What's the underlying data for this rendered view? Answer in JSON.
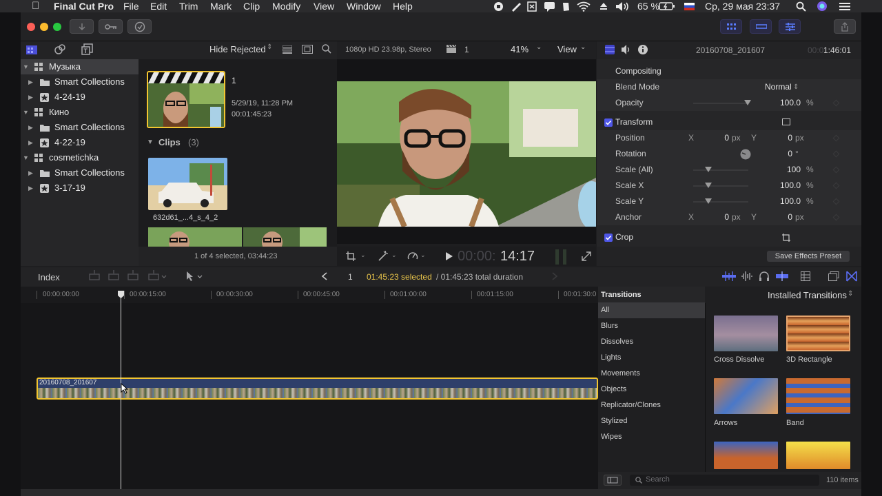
{
  "menubar": {
    "app_name": "Final Cut Pro",
    "items": [
      "File",
      "Edit",
      "Trim",
      "Mark",
      "Clip",
      "Modify",
      "View",
      "Window",
      "Help"
    ],
    "battery": "65 %",
    "datetime": "Ср, 29 мая  23:37"
  },
  "library": {
    "rows": [
      {
        "label": "Музыка",
        "level": 0,
        "kind": "library"
      },
      {
        "label": "Smart Collections",
        "level": 1,
        "kind": "folder"
      },
      {
        "label": "4-24-19",
        "level": 1,
        "kind": "event"
      },
      {
        "label": "Кино",
        "level": 0,
        "kind": "library"
      },
      {
        "label": "Smart Collections",
        "level": 1,
        "kind": "folder"
      },
      {
        "label": "4-22-19",
        "level": 1,
        "kind": "event"
      },
      {
        "label": "cosmetichka",
        "level": 0,
        "kind": "library"
      },
      {
        "label": "Smart Collections",
        "level": 1,
        "kind": "folder"
      },
      {
        "label": "3-17-19",
        "level": 1,
        "kind": "event"
      }
    ]
  },
  "browser": {
    "filter": "Hide Rejected",
    "project_name": "1",
    "project_date": "5/29/19, 11:28 PM",
    "project_duration": "00:01:45:23",
    "clips_header": "Clips",
    "clips_count": "(3)",
    "clip_name": "632d61_...4_s_4_2",
    "status": "1 of 4 selected, 03:44:23"
  },
  "viewer": {
    "format": "1080p HD 23.98p, Stereo",
    "clip_count": "1",
    "zoom": "41%",
    "view_label": "View",
    "timecode_dim": "00:00:",
    "timecode": "14:17"
  },
  "inspector": {
    "clip_name": "20160708_201607",
    "duration_dim": "00:0",
    "duration": "1:46:01",
    "compositing": "Compositing",
    "blend_mode_label": "Blend Mode",
    "blend_mode_value": "Normal",
    "opacity_label": "Opacity",
    "opacity_value": "100.0",
    "transform": "Transform",
    "position_label": "Position",
    "rotation_label": "Rotation",
    "rotation_value": "0",
    "scale_all_label": "Scale (All)",
    "scale_all_value": "100",
    "scale_x_label": "Scale X",
    "scale_x_value": "100.0",
    "scale_y_label": "Scale Y",
    "scale_y_value": "100.0",
    "anchor_label": "Anchor",
    "axis_x": "X",
    "axis_y": "Y",
    "zero": "0",
    "unit_px": "px",
    "unit_pct": "%",
    "unit_deg": "°",
    "crop": "Crop",
    "save_preset": "Save Effects Preset"
  },
  "timeline": {
    "index_label": "Index",
    "page": "1",
    "selected_text": "01:45:23 selected",
    "total_text": " / 01:45:23 total duration",
    "ruler": [
      "00:00:00:00",
      "00:00:15:00",
      "00:00:30:00",
      "00:00:45:00",
      "00:01:00:00",
      "00:01:15:00",
      "00:01:30:0"
    ],
    "clip_name": "20160708_201607"
  },
  "transitions": {
    "header": "Transitions",
    "installed": "Installed Transitions",
    "categories": [
      "All",
      "Blurs",
      "Dissolves",
      "Lights",
      "Movements",
      "Objects",
      "Replicator/Clones",
      "Stylized",
      "Wipes"
    ],
    "items": [
      "Cross Dissolve",
      "3D Rectangle",
      "Arrows",
      "Band"
    ],
    "search_placeholder": "Search",
    "count": "110 items"
  }
}
